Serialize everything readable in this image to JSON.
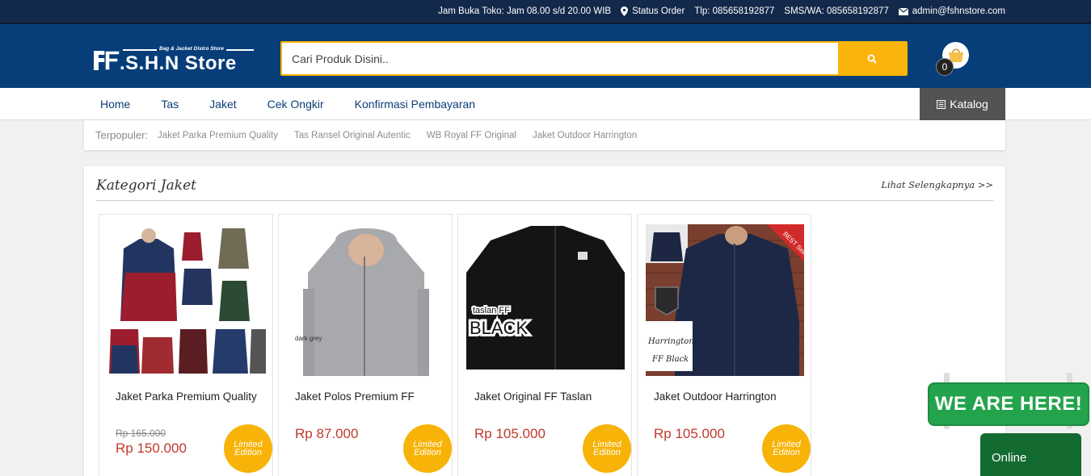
{
  "topbar": {
    "hours": "Jam Buka Toko: Jam 08.00 s/d 20.00 WIB",
    "status_order": "Status Order",
    "phone": "Tlp: 085658192877",
    "sms": "SMS/WA: 085658192877",
    "email": "admin@fshnstore.com"
  },
  "header": {
    "logo_name": ".S.H.N Store",
    "logo_tagline": "Bag & Jacket Distro Store",
    "search_placeholder": "Cari Produk Disini..",
    "cart_count": "0"
  },
  "nav": {
    "items": [
      "Home",
      "Tas",
      "Jaket",
      "Cek Ongkir",
      "Konfirmasi Pembayaran"
    ],
    "katalog": "Katalog"
  },
  "popular": {
    "label": "Terpopuler:",
    "links": [
      "Jaket Parka Premium Quality",
      "Tas Ransel Original Autentic",
      "WB Royal FF Original",
      "Jaket Outdoor Harrington"
    ]
  },
  "category": {
    "title": "Kategori Jaket",
    "more": "Lihat Selengkapnya >>",
    "products": [
      {
        "name": "Jaket Parka Premium Quality",
        "old_price": "Rp 165.000",
        "price": "Rp 150.000",
        "badge": [
          "Limited",
          "Edition"
        ]
      },
      {
        "name": "Jaket Polos Premium FF",
        "old_price": "",
        "price": "Rp 87.000",
        "badge": [
          "Limited",
          "Edition"
        ]
      },
      {
        "name": "Jaket Original FF Taslan",
        "old_price": "",
        "price": "Rp 105.000",
        "badge": [
          "Limited",
          "Edition"
        ]
      },
      {
        "name": "Jaket Outdoor Harrington",
        "old_price": "",
        "price": "Rp 105.000",
        "badge": [
          "Limited",
          "Edition"
        ]
      }
    ],
    "image_texts": {
      "p2_color": "dark grey",
      "p3_line1": "taslan FF",
      "p3_line2": "BLACK",
      "p4_line1": "Harrington",
      "p4_line2": "FF Black",
      "p4_ribbon": "BEST Seller"
    }
  },
  "chat": {
    "sign": "WE ARE HERE!",
    "status": "Online"
  },
  "colors": {
    "topbar": "#13294b",
    "header": "#073e7a",
    "accent": "#fbb40b",
    "price": "#c0392b",
    "chat_green": "#23a34c"
  }
}
